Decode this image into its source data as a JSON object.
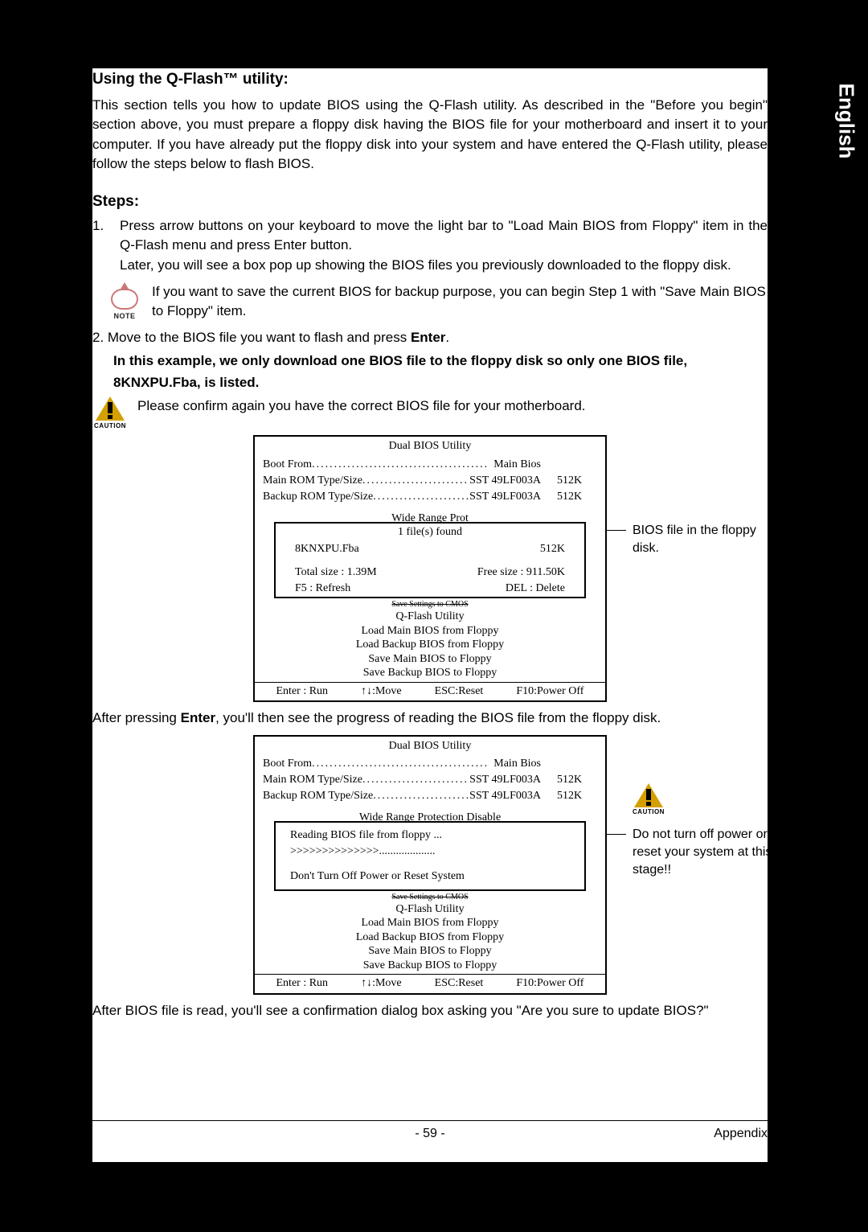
{
  "lang_tab": "English",
  "section_title": "Using the Q-Flash™ utility:",
  "intro": "This section tells you how to update BIOS using the Q-Flash utility. As described in the \"Before you begin\" section above, you must prepare a floppy disk having the BIOS file for your motherboard and insert it to your computer. If you have already put the floppy disk into your system and have entered the Q-Flash utility, please follow the steps below to flash BIOS.",
  "steps_title": "Steps:",
  "step1_num": "1.",
  "step1a": "Press arrow buttons on your keyboard to move the light bar to \"Load Main BIOS from Floppy\" item in the Q-Flash menu and press Enter button.",
  "step1b": "Later, you will see a box pop up showing the BIOS files you previously downloaded to the floppy disk.",
  "note_label": "NOTE",
  "note_text": "If you want to save the current BIOS for backup purpose, you can begin Step 1 with \"Save Main BIOS to Floppy\" item.",
  "step2_pre": "2. Move to the BIOS file you want to flash and press ",
  "step2_enter": "Enter",
  "step2_post": ".",
  "step2_bold": "In this example, we only download one BIOS file to the floppy disk so only one BIOS file, 8KNXPU.Fba, is listed.",
  "caution_label": "CAUTION",
  "caution_text": "Please confirm again you have the correct BIOS file for your motherboard.",
  "bios": {
    "title": "Dual BIOS Utility",
    "boot_from_label": "Boot From",
    "boot_from_value": "Main Bios",
    "main_rom_label": "Main ROM Type/Size",
    "main_rom_value": "SST 49LF003A",
    "main_rom_size": "512K",
    "backup_rom_label": "Backup ROM Type/Size",
    "backup_rom_value": "SST 49LF003A",
    "backup_rom_size": "512K",
    "wide_range_partial": "Wide Range Prot",
    "wide_range_full": "Wide Range Protection    Disable",
    "popup_header": "1 file(s) found",
    "popup_file": "8KNXPU.Fba",
    "popup_file_size": "512K",
    "popup_total": "Total size : 1.39M",
    "popup_free": "Free size : 911.50K",
    "popup_f5": "F5 : Refresh",
    "popup_del": "DEL : Delete",
    "popup2_reading": "Reading BIOS file from floppy ...",
    "popup2_progress": ">>>>>>>>>>>>>>....................",
    "popup2_warn": "Don't Turn Off Power or Reset System",
    "cut_text": "Save Settings to CMOS",
    "qflash_title": "Q-Flash Utility",
    "menu1": "Load Main BIOS from Floppy",
    "menu2": "Load Backup BIOS from Floppy",
    "menu3": "Save Main BIOS to Floppy",
    "menu4": "Save Backup BIOS to Floppy",
    "foot_enter": "Enter : Run",
    "foot_move": "↑↓:Move",
    "foot_esc": "ESC:Reset",
    "foot_f10": "F10:Power Off"
  },
  "callout1": "BIOS file in the floppy disk.",
  "after1_pre": "After pressing ",
  "after1_enter": "Enter",
  "after1_post": ", you'll then see the progress of reading the BIOS file from the floppy disk.",
  "callout2": "Do not turn off power or reset your system at this stage!!",
  "after2": "After BIOS file is read, you'll see a confirmation dialog box asking you \"Are you sure to update BIOS?\"",
  "page_number": "- 59 -",
  "appendix": "Appendix"
}
